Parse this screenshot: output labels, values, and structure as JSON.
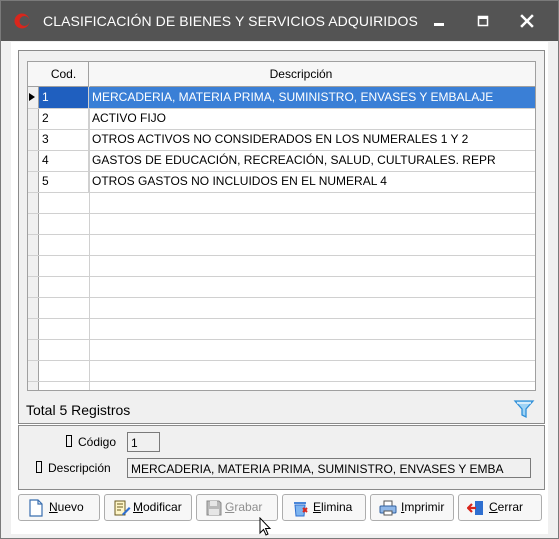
{
  "window": {
    "title": "CLASIFICACIÓN DE BIENES Y SERVICIOS ADQUIRIDOS",
    "controls": [
      "minimize-icon",
      "maximize-icon",
      "close-icon"
    ]
  },
  "grid": {
    "columns": [
      "Cod.",
      "Descripción"
    ],
    "rows": [
      {
        "cod": "1",
        "desc": "MERCADERIA, MATERIA PRIMA, SUMINISTRO, ENVASES Y EMBALAJE",
        "selected": true
      },
      {
        "cod": "2",
        "desc": "ACTIVO FIJO"
      },
      {
        "cod": "3",
        "desc": "OTROS ACTIVOS NO CONSIDERADOS EN LOS NUMERALES 1 Y 2"
      },
      {
        "cod": "4",
        "desc": "GASTOS DE EDUCACIÓN, RECREACIÓN, SALUD, CULTURALES. REPR"
      },
      {
        "cod": "5",
        "desc": "OTROS GASTOS NO INCLUIDOS EN EL NUMERAL 4"
      }
    ],
    "total_label": "Total 5 Registros"
  },
  "detail": {
    "codigo_label": "Código",
    "codigo_value": "1",
    "descripcion_label": "Descripción",
    "descripcion_value": "MERCADERIA, MATERIA PRIMA, SUMINISTRO, ENVASES Y EMBA"
  },
  "buttons": {
    "nuevo": {
      "first": "N",
      "rest": "uevo"
    },
    "modificar": {
      "first": "M",
      "rest": "odificar"
    },
    "grabar": {
      "first": "G",
      "rest": "rabar"
    },
    "elimina": {
      "first": "E",
      "rest": "limina"
    },
    "imprimir": {
      "first": "I",
      "rest": "mprimir"
    },
    "cerrar": {
      "first": "C",
      "rest": "errar"
    }
  },
  "colors": {
    "titlebar": "#545454",
    "selection": "#3a7fd6",
    "accent_red": "#d9261c"
  }
}
